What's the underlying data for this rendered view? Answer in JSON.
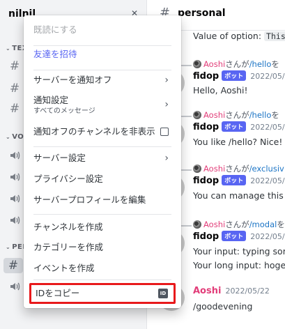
{
  "server": {
    "name": "nilnil"
  },
  "categories": {
    "text": "TEXT",
    "voice": "VOIC",
    "personal": "PERS"
  },
  "channel": {
    "name": "personal"
  },
  "messages": [
    {
      "type": "text",
      "content_prefix": "Value of option: ",
      "content_code": "This"
    },
    {
      "type": "reply",
      "name": "Aoshi",
      "sep": "さんが",
      "cmd": "/hello",
      "suffix": "を"
    },
    {
      "type": "author",
      "author": "fidop",
      "badge": "ボット",
      "time": "2022/05/2"
    },
    {
      "type": "text",
      "content": "Hello, Aoshi!"
    },
    {
      "type": "reply",
      "name": "Aoshi",
      "sep": "さんが",
      "cmd": "/hello",
      "suffix": "を"
    },
    {
      "type": "author",
      "author": "fidop",
      "badge": "ボット",
      "time": "2022/05/2"
    },
    {
      "type": "text",
      "content": "You like /hello? Nice!"
    },
    {
      "type": "reply",
      "name": "Aoshi",
      "sep": "さんが",
      "cmd": "/exclusiv",
      "suffix": ""
    },
    {
      "type": "author",
      "author": "fidop",
      "badge": "ボット",
      "time": "2022/05/2"
    },
    {
      "type": "text",
      "content": "You can manage this g"
    },
    {
      "type": "reply",
      "name": "Aoshi",
      "sep": "さんが",
      "cmd": "/modal",
      "suffix": "を"
    },
    {
      "type": "author",
      "author": "fidop",
      "badge": "ボット",
      "time": "2022/05/2"
    },
    {
      "type": "text",
      "content": "Your input: typing som"
    },
    {
      "type": "text",
      "content": "Your long input: hoge"
    },
    {
      "type": "author",
      "author": "Aoshi",
      "time": "2022/05/22"
    },
    {
      "type": "text",
      "content": "/goodevening"
    }
  ],
  "context_menu": {
    "mark_read": "既読にする",
    "invite": "友達を招待",
    "mute_server": "サーバーを通知オフ",
    "notification_settings": "通知設定",
    "notification_sub": "すべてのメッセージ",
    "hide_muted": "通知オフのチャンネルを非表示",
    "server_settings": "サーバー設定",
    "privacy_settings": "プライバシー設定",
    "edit_profile": "サーバープロフィールを編集",
    "create_channel": "チャンネルを作成",
    "create_category": "カテゴリーを作成",
    "create_event": "イベントを作成",
    "copy_id": "IDをコピー",
    "id_badge": "ID"
  },
  "colors": {
    "accent": "#5865f2",
    "highlight": "#e8191b",
    "mention_name": "#e23d79",
    "command": "#1b74c5"
  }
}
